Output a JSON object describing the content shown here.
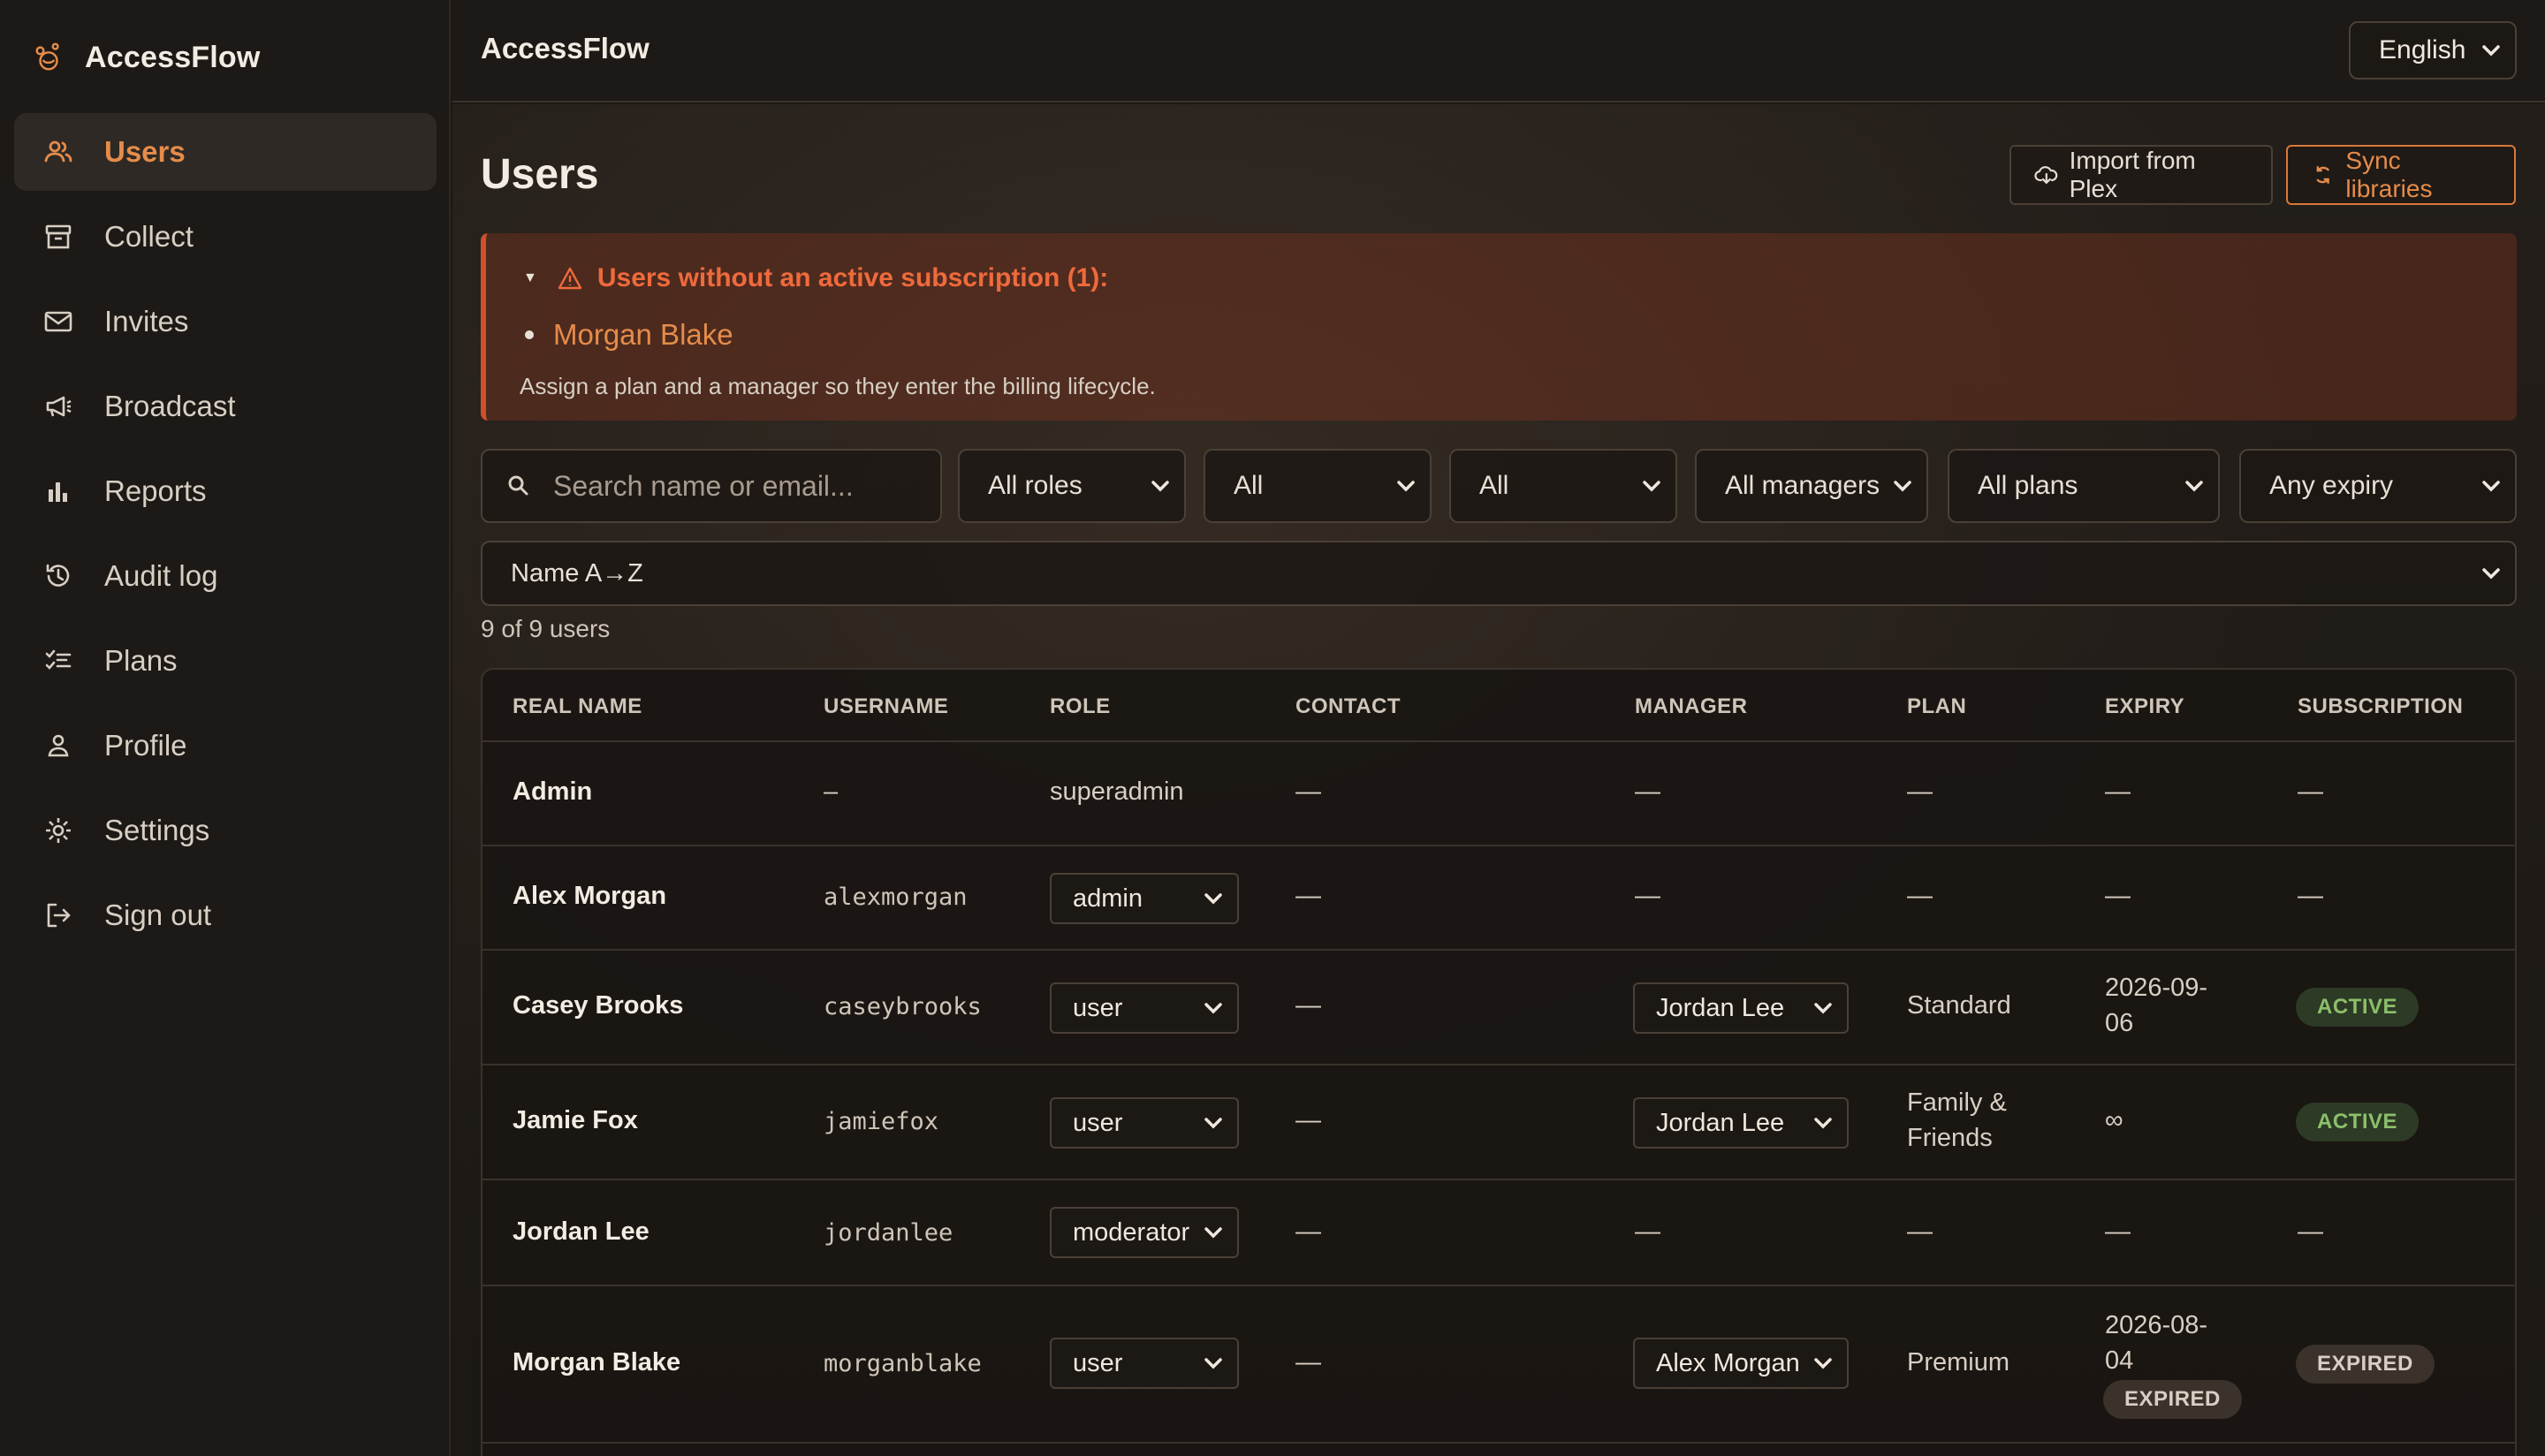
{
  "app": {
    "name": "AccessFlow"
  },
  "sidebar": {
    "items": [
      {
        "label": "Users",
        "icon": "users-icon",
        "active": true
      },
      {
        "label": "Collect",
        "icon": "archive-icon"
      },
      {
        "label": "Invites",
        "icon": "mail-icon"
      },
      {
        "label": "Broadcast",
        "icon": "megaphone-icon"
      },
      {
        "label": "Reports",
        "icon": "bar-chart-icon"
      },
      {
        "label": "Audit log",
        "icon": "history-icon"
      },
      {
        "label": "Plans",
        "icon": "checklist-icon"
      },
      {
        "label": "Profile",
        "icon": "person-icon"
      },
      {
        "label": "Settings",
        "icon": "gear-icon"
      },
      {
        "label": "Sign out",
        "icon": "sign-out-icon"
      }
    ]
  },
  "header": {
    "title": "AccessFlow",
    "language": "English"
  },
  "page": {
    "title": "Users",
    "import_label": "Import from Plex",
    "sync_label": "Sync libraries"
  },
  "alert": {
    "title": "Users without an active subscription (1):",
    "items": [
      "Morgan Blake"
    ],
    "note": "Assign a plan and a manager so they enter the billing lifecycle."
  },
  "filters": {
    "search_placeholder": "Search name or email...",
    "role": "All roles",
    "filter2": "All",
    "filter3": "All",
    "manager": "All managers",
    "plan": "All plans",
    "expiry": "Any expiry",
    "sort": "Name A→Z"
  },
  "count": "9 of 9 users",
  "table": {
    "headers": [
      "REAL NAME",
      "USERNAME",
      "ROLE",
      "CONTACT",
      "MANAGER",
      "PLAN",
      "EXPIRY",
      "SUBSCRIPTION"
    ],
    "rows": [
      {
        "name": "Admin",
        "username": "–",
        "role": "superadmin",
        "contact": "—",
        "manager": "—",
        "plan": "—",
        "expiry": "—",
        "subscription": "—"
      },
      {
        "name": "Alex Morgan",
        "username": "alexmorgan",
        "role": "admin",
        "contact": "—",
        "manager": "—",
        "plan": "—",
        "expiry": "—",
        "subscription": "—"
      },
      {
        "name": "Casey Brooks",
        "username": "caseybrooks",
        "role": "user",
        "contact": "—",
        "manager": "Jordan Lee",
        "plan": "Standard",
        "expiry_line1": "2026-09-",
        "expiry_line2": "06",
        "subscription": "ACTIVE"
      },
      {
        "name": "Jamie Fox",
        "username": "jamiefox",
        "role": "user",
        "contact": "—",
        "manager": "Jordan Lee",
        "plan_line1": "Family &",
        "plan_line2": "Friends",
        "expiry": "∞",
        "subscription": "ACTIVE"
      },
      {
        "name": "Jordan Lee",
        "username": "jordanlee",
        "role": "moderator",
        "contact": "—",
        "manager": "—",
        "plan": "—",
        "expiry": "—",
        "subscription": "—"
      },
      {
        "name": "Morgan Blake",
        "username": "morganblake",
        "role": "user",
        "contact": "—",
        "manager": "Alex Morgan",
        "plan": "Premium",
        "expiry_line1": "2026-08-",
        "expiry_line2": "04",
        "expiry_badge": "EXPIRED",
        "subscription": "EXPIRED"
      }
    ]
  },
  "colors": {
    "accent": "#e58c4a",
    "alert": "#ef6a3c",
    "active_badge": "#8cbf6a"
  }
}
